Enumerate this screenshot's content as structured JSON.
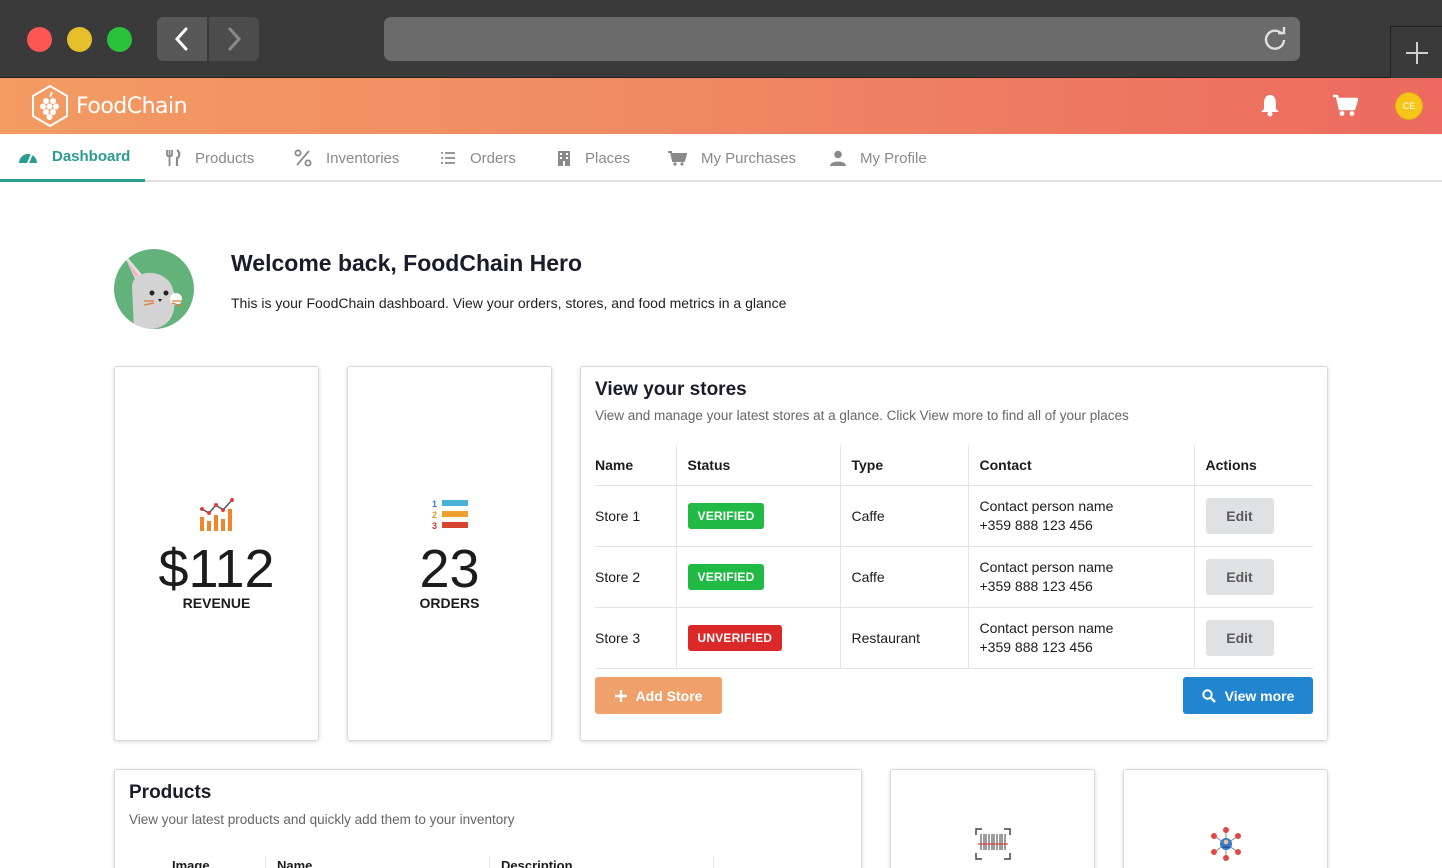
{
  "app": {
    "name": "FoodChain"
  },
  "header": {
    "avatar_initials": "CE"
  },
  "tabs": [
    {
      "label": "Dashboard",
      "icon": "dashboard-icon",
      "active": true
    },
    {
      "label": "Products",
      "icon": "utensils-icon"
    },
    {
      "label": "Inventories",
      "icon": "percent-icon"
    },
    {
      "label": "Orders",
      "icon": "list-icon"
    },
    {
      "label": "Places",
      "icon": "building-icon"
    },
    {
      "label": "My Purchases",
      "icon": "cart-icon"
    },
    {
      "label": "My Profile",
      "icon": "user-icon"
    }
  ],
  "welcome": {
    "title": "Welcome back, FoodChain Hero",
    "subtitle": "This is your FoodChain dashboard. View your orders, stores, and food metrics in a glance"
  },
  "stats": {
    "revenue": {
      "value": "$112",
      "label": "REVENUE"
    },
    "orders": {
      "value": "23",
      "label": "ORDERS"
    }
  },
  "stores": {
    "title": "View your stores",
    "subtitle": "View and manage your latest stores at a glance. Click View more to find all of your places",
    "columns": [
      "Name",
      "Status",
      "Type",
      "Contact",
      "Actions"
    ],
    "rows": [
      {
        "name": "Store 1",
        "status": "VERIFIED",
        "status_color": "#21ba45",
        "type": "Caffe",
        "contact_name": "Contact person name",
        "contact_phone": "+359 888 123 456",
        "action": "Edit"
      },
      {
        "name": "Store 2",
        "status": "VERIFIED",
        "status_color": "#21ba45",
        "type": "Caffe",
        "contact_name": "Contact person name",
        "contact_phone": "+359 888 123 456",
        "action": "Edit"
      },
      {
        "name": "Store 3",
        "status": "UNVERIFIED",
        "status_color": "#db2828",
        "type": "Restaurant",
        "contact_name": "Contact person name",
        "contact_phone": "+359 888 123 456",
        "action": "Edit"
      }
    ],
    "add_label": "Add Store",
    "more_label": "View more"
  },
  "products": {
    "title": "Products",
    "subtitle": "View your latest products and quickly add them to your inventory",
    "columns": [
      "Image",
      "Name",
      "Description"
    ]
  }
}
